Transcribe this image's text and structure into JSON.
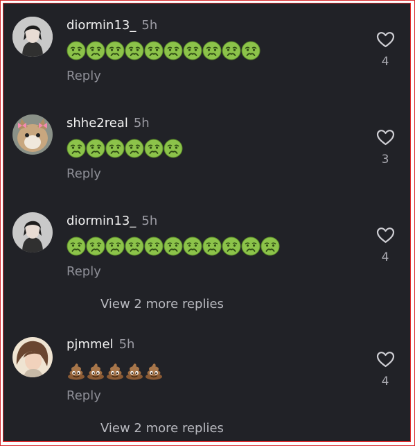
{
  "comments": [
    {
      "username": "diormin13_",
      "time": "5h",
      "emoji": "nauseated-face",
      "emoji_count": 10,
      "reply_label": "Reply",
      "likes": "4",
      "avatar": "dark-haired-person-avatar"
    },
    {
      "username": "shhe2real",
      "time": "5h",
      "emoji": "nauseated-face",
      "emoji_count": 6,
      "reply_label": "Reply",
      "likes": "3",
      "avatar": "cat-avatar"
    },
    {
      "username": "diormin13_",
      "time": "5h",
      "emoji": "nauseated-face",
      "emoji_count": 11,
      "reply_label": "Reply",
      "likes": "4",
      "avatar": "dark-haired-person-avatar",
      "view_more": "View 2 more replies"
    },
    {
      "username": "pjmmel",
      "time": "5h",
      "emoji": "pile-of-poo",
      "emoji_count": 5,
      "reply_label": "Reply",
      "likes": "4",
      "avatar": "curly-haired-person-avatar",
      "view_more": "View 2 more replies"
    }
  ],
  "colors": {
    "background": "#212227",
    "username": "#f2f2f2",
    "muted": "#9c9ca4",
    "frame_border": "#d9292b"
  }
}
